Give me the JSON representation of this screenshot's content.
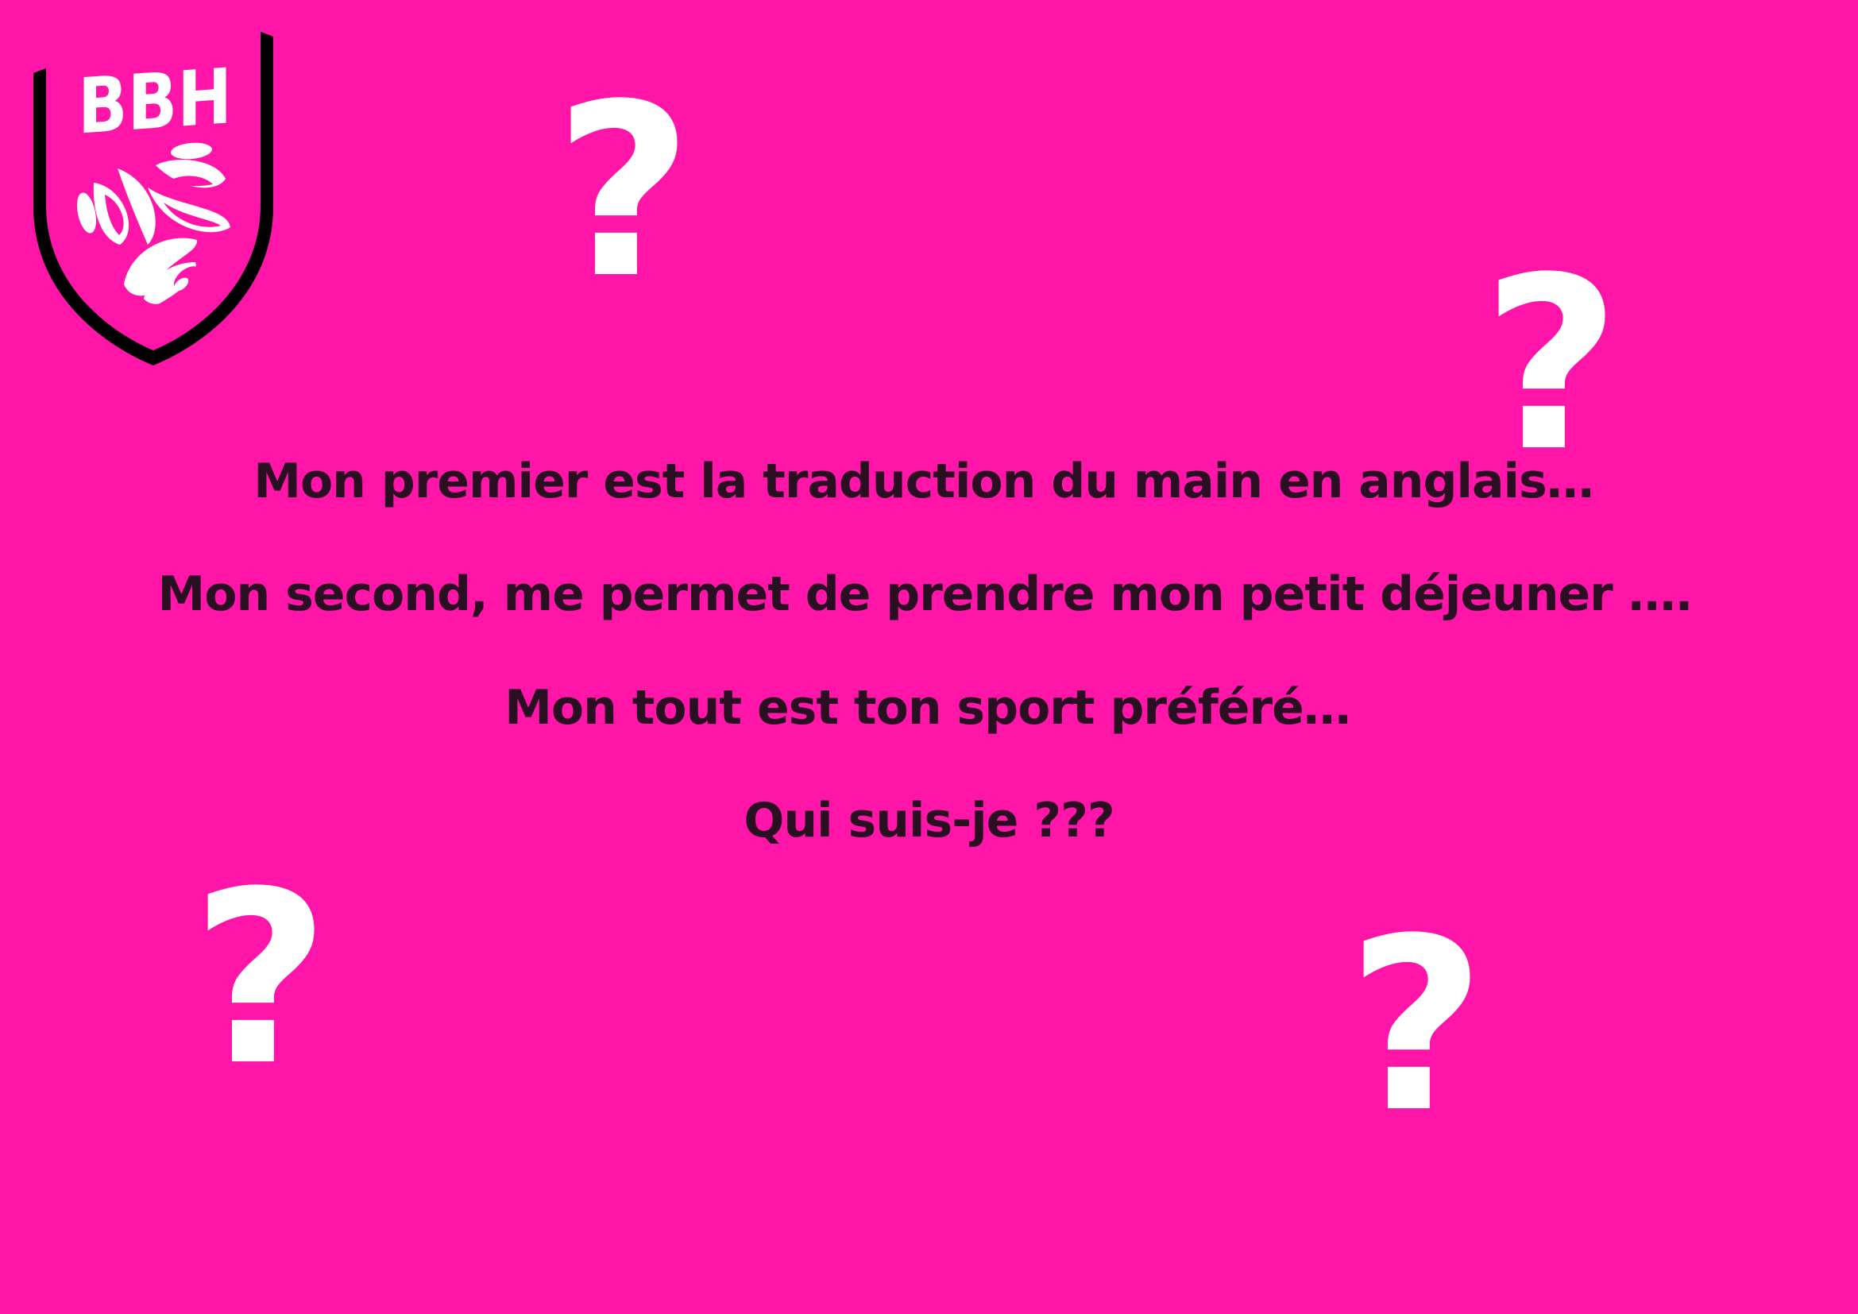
{
  "logo": {
    "text": "BBH",
    "shield_border_color": "#000000",
    "foreground_color": "#FFFFFF"
  },
  "background_color": "#FF16A9",
  "decorations": {
    "question_mark_glyph": "?",
    "question_mark_color": "#FFFFFF"
  },
  "riddle": {
    "line1": "Mon premier est la traduction du main en anglais…",
    "line2": "Mon second, me permet de prendre mon petit déjeuner ….",
    "line3": "Mon tout est ton sport préféré…",
    "line4": "Qui suis-je ???",
    "text_color": "#2A0E22"
  }
}
